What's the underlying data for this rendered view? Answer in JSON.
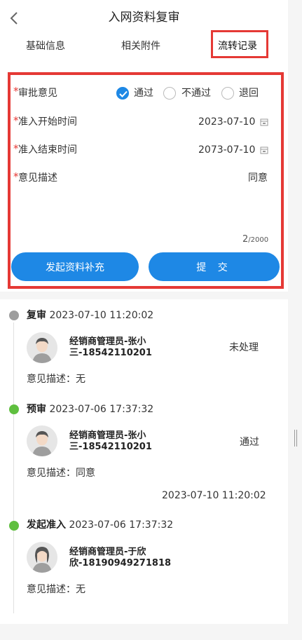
{
  "header": {
    "title": "入网资料复审",
    "tabs": [
      "基础信息",
      "相关附件",
      "流转记录"
    ]
  },
  "form": {
    "approval_label": "审批意见",
    "options": [
      "通过",
      "不通过",
      "退回"
    ],
    "selected_option": "通过",
    "start_label": "准入开始时间",
    "start_value": "2023-07-10",
    "end_label": "准入结束时间",
    "end_value": "2073-07-10",
    "desc_label": "意见描述",
    "desc_value": "同意",
    "counter_current": "2",
    "counter_max": "/2000",
    "btn_supplement": "发起资料补充",
    "btn_submit": "提 交"
  },
  "timeline": [
    {
      "step": "复审",
      "time": "2023-07-10 11:20:02",
      "person": "经销商管理员-张小三-18542110201",
      "status": "未处理",
      "opinion": "意见描述：无",
      "dot": "#9e9e9e"
    },
    {
      "step": "预审",
      "time": "2023-07-06 17:37:32",
      "person": "经销商管理员-张小三-18542110201",
      "status": "通过",
      "opinion": "意见描述：同意",
      "done_time": "2023-07-10 11:20:02",
      "dot": "#5fbf3f"
    },
    {
      "step": "发起准入",
      "time": "2023-07-06 17:37:32",
      "person": "经销商管理员-于欣欣-18190949271818",
      "status": "",
      "opinion": "意见描述：无",
      "dot": "#5fbf3f"
    }
  ],
  "colors": {
    "accent": "#1e88e5",
    "highlight": "#e53935",
    "pending": "#9e9e9e",
    "done": "#5fbf3f"
  }
}
